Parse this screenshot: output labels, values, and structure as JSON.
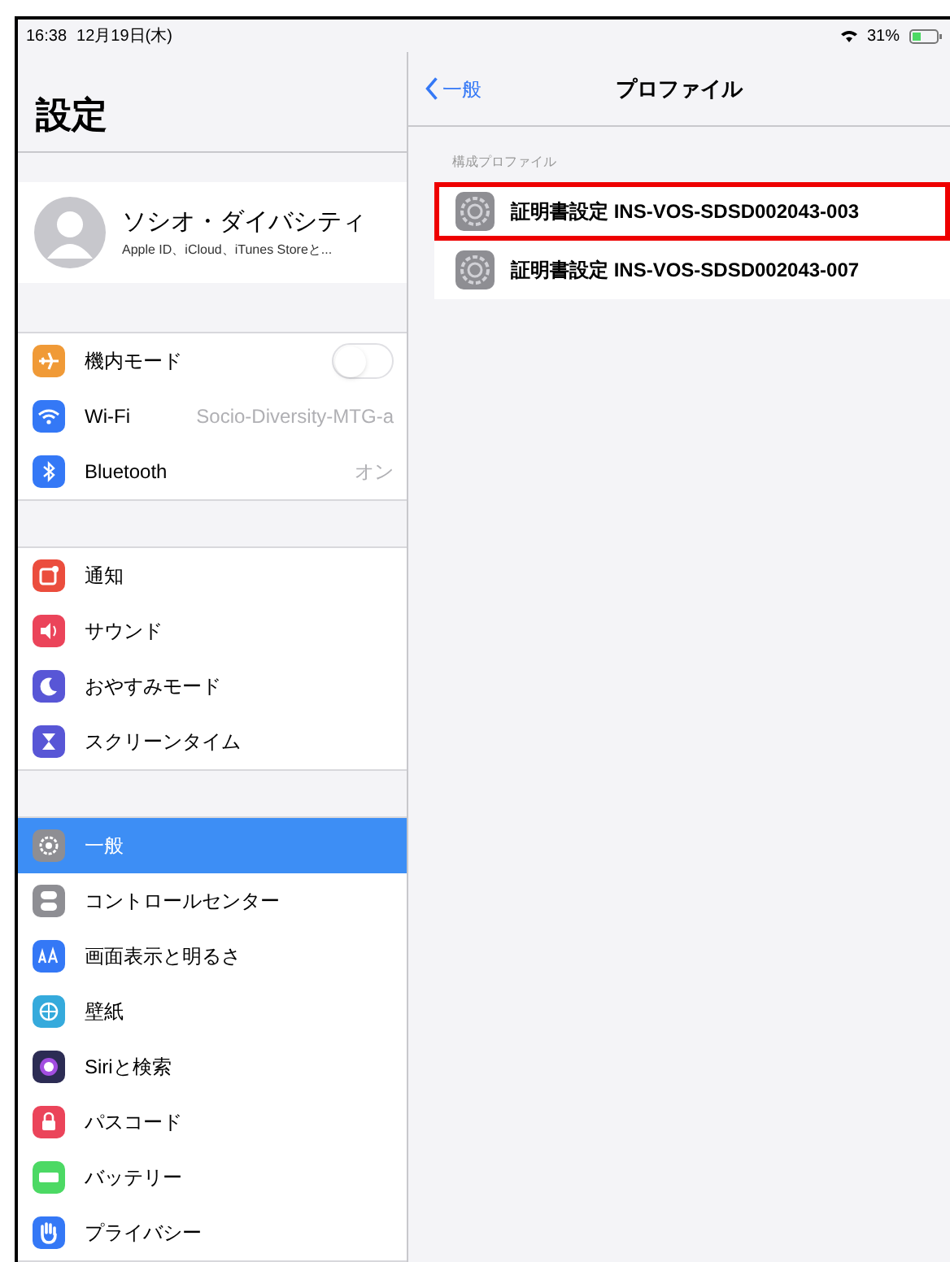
{
  "status_bar": {
    "time": "16:38",
    "date": "12月19日(木)",
    "battery": "31%"
  },
  "sidebar": {
    "title": "設定",
    "account": {
      "name": "ソシオ・ダイバシティ",
      "subtitle": "Apple ID、iCloud、iTunes Storeと..."
    },
    "groups": [
      [
        {
          "label": "機内モード",
          "kind": "toggle",
          "on": false,
          "color": "#f09a37",
          "selected": false
        },
        {
          "label": "Wi-Fi",
          "kind": "value",
          "value": "Socio-Diversity-MTG-a",
          "color": "#3478f6",
          "selected": false
        },
        {
          "label": "Bluetooth",
          "kind": "value",
          "value": "オン",
          "color": "#3478f6",
          "selected": false
        }
      ],
      [
        {
          "label": "通知",
          "kind": "plain",
          "color": "#eb4d3d",
          "selected": false
        },
        {
          "label": "サウンド",
          "kind": "plain",
          "color": "#eb445a",
          "selected": false
        },
        {
          "label": "おやすみモード",
          "kind": "plain",
          "color": "#5856d6",
          "selected": false
        },
        {
          "label": "スクリーンタイム",
          "kind": "plain",
          "color": "#5856d6",
          "selected": false
        }
      ],
      [
        {
          "label": "一般",
          "kind": "plain",
          "color": "#8e8e93",
          "selected": true
        },
        {
          "label": "コントロールセンター",
          "kind": "plain",
          "color": "#8e8e93",
          "selected": false
        },
        {
          "label": "画面表示と明るさ",
          "kind": "plain",
          "color": "#3478f6",
          "selected": false
        },
        {
          "label": "壁紙",
          "kind": "plain",
          "color": "#35aadc",
          "selected": false
        },
        {
          "label": "Siriと検索",
          "kind": "plain",
          "color": "#2c2c54",
          "selected": false
        },
        {
          "label": "パスコード",
          "kind": "plain",
          "color": "#eb445a",
          "selected": false
        },
        {
          "label": "バッテリー",
          "kind": "plain",
          "color": "#4cd964",
          "selected": false
        },
        {
          "label": "プライバシー",
          "kind": "plain",
          "color": "#3478f6",
          "selected": false
        }
      ]
    ]
  },
  "detail": {
    "back": "一般",
    "title": "プロファイル",
    "section": "構成プロファイル",
    "profiles": [
      {
        "label": "証明書設定 INS-VOS-SDSD002043-003",
        "highlighted": true
      },
      {
        "label": "証明書設定 INS-VOS-SDSD002043-007",
        "highlighted": false
      }
    ]
  }
}
